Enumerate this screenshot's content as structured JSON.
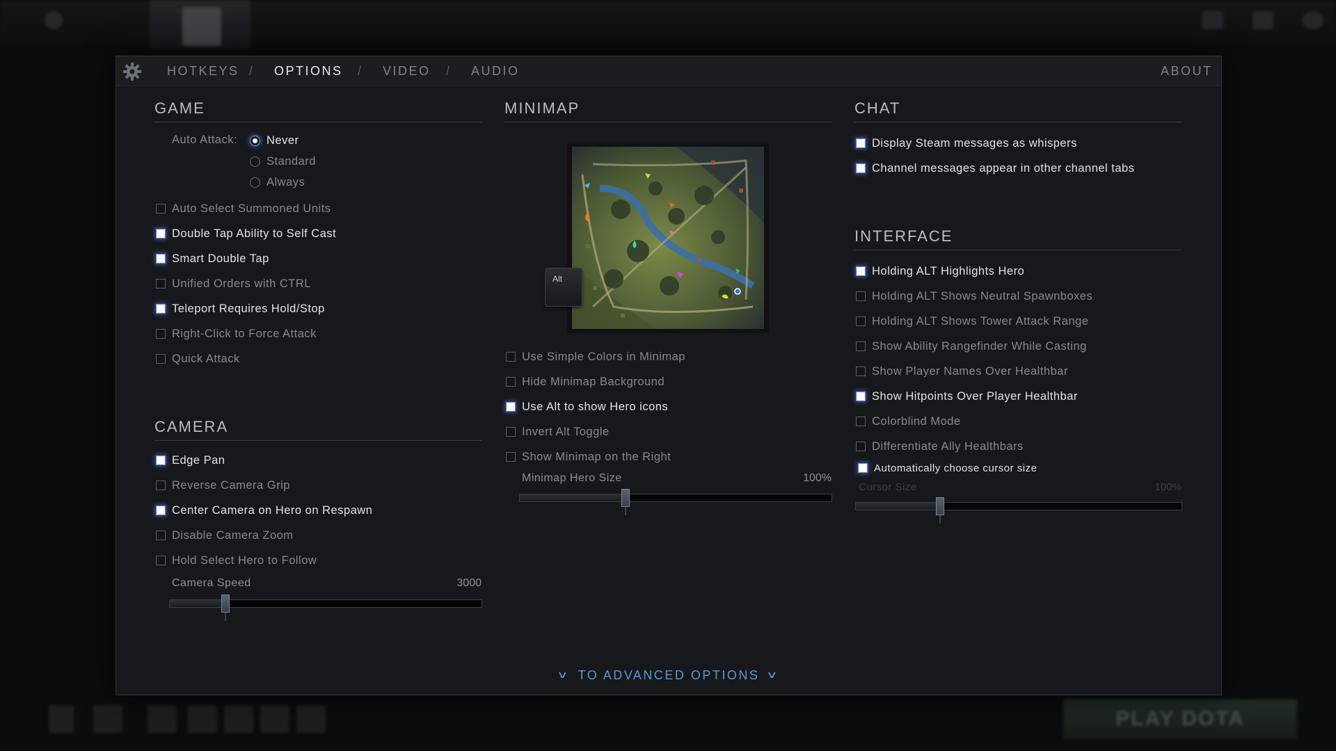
{
  "tabs": [
    {
      "label": "HOTKEYS",
      "active": false
    },
    {
      "label": "OPTIONS",
      "active": true
    },
    {
      "label": "VIDEO",
      "active": false
    },
    {
      "label": "AUDIO",
      "active": false
    }
  ],
  "tab_separator": "/",
  "about": "ABOUT",
  "game": {
    "title": "GAME",
    "auto_attack_label": "Auto Attack:",
    "auto_attack_options": [
      {
        "label": "Never",
        "selected": true
      },
      {
        "label": "Standard",
        "selected": false
      },
      {
        "label": "Always",
        "selected": false
      }
    ],
    "options": [
      {
        "label": "Auto Select Summoned Units",
        "checked": false
      },
      {
        "label": "Double Tap Ability to Self Cast",
        "checked": true
      },
      {
        "label": "Smart Double Tap",
        "checked": true
      },
      {
        "label": "Unified Orders with CTRL",
        "checked": false
      },
      {
        "label": "Teleport Requires Hold/Stop",
        "checked": true
      },
      {
        "label": "Right-Click to Force Attack",
        "checked": false
      },
      {
        "label": "Quick Attack",
        "checked": false
      }
    ]
  },
  "camera": {
    "title": "CAMERA",
    "options": [
      {
        "label": "Edge Pan",
        "checked": true
      },
      {
        "label": "Reverse Camera Grip",
        "checked": false
      },
      {
        "label": "Center Camera on Hero on Respawn",
        "checked": true
      },
      {
        "label": "Disable Camera Zoom",
        "checked": false
      },
      {
        "label": "Hold Select Hero to Follow",
        "checked": false
      }
    ],
    "speed_label": "Camera Speed",
    "speed_value": "3000",
    "speed_fraction": 0.18
  },
  "minimap": {
    "title": "MINIMAP",
    "alt_key": "Alt",
    "options": [
      {
        "label": "Use Simple Colors in Minimap",
        "checked": false
      },
      {
        "label": "Hide Minimap Background",
        "checked": false
      },
      {
        "label": "Use Alt to show Hero icons",
        "checked": true
      },
      {
        "label": "Invert Alt Toggle",
        "checked": false
      },
      {
        "label": "Show Minimap on the Right",
        "checked": false
      }
    ],
    "hero_size_label": "Minimap Hero Size",
    "hero_size_value": "100%",
    "hero_size_fraction": 0.34
  },
  "chat": {
    "title": "CHAT",
    "options": [
      {
        "label": "Display Steam messages as whispers",
        "checked": true
      },
      {
        "label": "Channel messages appear in other channel tabs",
        "checked": true
      }
    ]
  },
  "interface": {
    "title": "INTERFACE",
    "options": [
      {
        "label": "Holding ALT Highlights Hero",
        "checked": true
      },
      {
        "label": "Holding ALT Shows Neutral Spawnboxes",
        "checked": false
      },
      {
        "label": "Holding ALT Shows Tower Attack Range",
        "checked": false
      },
      {
        "label": "Show Ability Rangefinder While Casting",
        "checked": false
      },
      {
        "label": "Show Player Names Over Healthbar",
        "checked": false
      },
      {
        "label": "Show Hitpoints Over Player Healthbar",
        "checked": true
      },
      {
        "label": "Colorblind Mode",
        "checked": false
      },
      {
        "label": "Differentiate Ally Healthbars",
        "checked": false
      },
      {
        "label": "Automatically choose cursor size",
        "checked": true
      }
    ],
    "cursor_size_label": "Cursor Size",
    "cursor_size_value": "100%",
    "cursor_size_fraction": 0.26
  },
  "advanced": "TO ADVANCED OPTIONS",
  "play": "PLAY DOTA",
  "colors": {
    "accent_blue": "#5a97d4",
    "checked_glow": "#6f86c8"
  }
}
